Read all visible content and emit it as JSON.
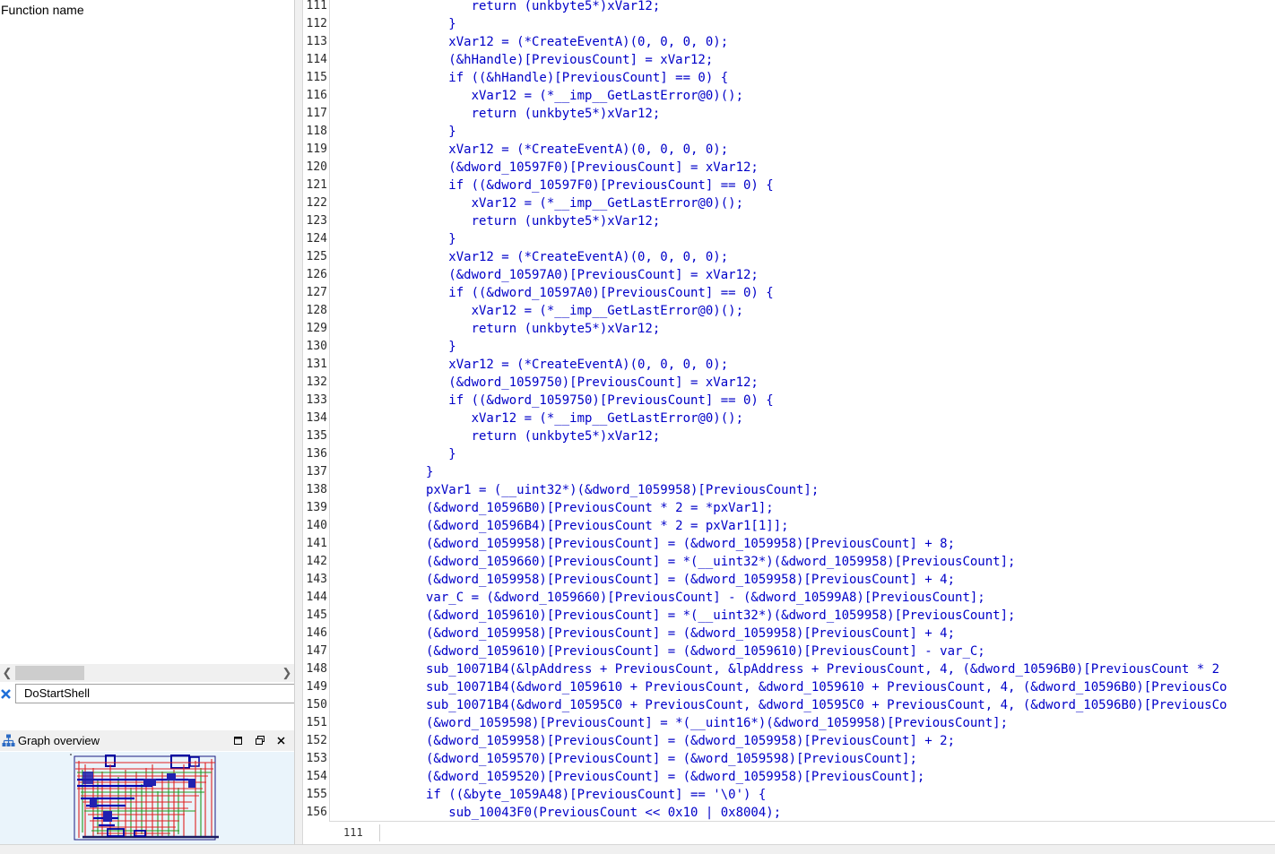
{
  "functions_panel": {
    "column_header": "Function name",
    "filter_value": "DoStartShell"
  },
  "graph_overview": {
    "title": "Graph overview"
  },
  "code_view": {
    "status_line": "111",
    "lines": [
      {
        "num": "111",
        "text": "      return (unkbyte5*)xVar12;"
      },
      {
        "num": "112",
        "text": "   }"
      },
      {
        "num": "113",
        "text": "   xVar12 = (*CreateEventA)(0, 0, 0, 0);"
      },
      {
        "num": "114",
        "text": "   (&hHandle)[PreviousCount] = xVar12;"
      },
      {
        "num": "115",
        "text": "   if ((&hHandle)[PreviousCount] == 0) {"
      },
      {
        "num": "116",
        "text": "      xVar12 = (*__imp__GetLastError@0)();"
      },
      {
        "num": "117",
        "text": "      return (unkbyte5*)xVar12;"
      },
      {
        "num": "118",
        "text": "   }"
      },
      {
        "num": "119",
        "text": "   xVar12 = (*CreateEventA)(0, 0, 0, 0);"
      },
      {
        "num": "120",
        "text": "   (&dword_10597F0)[PreviousCount] = xVar12;"
      },
      {
        "num": "121",
        "text": "   if ((&dword_10597F0)[PreviousCount] == 0) {"
      },
      {
        "num": "122",
        "text": "      xVar12 = (*__imp__GetLastError@0)();"
      },
      {
        "num": "123",
        "text": "      return (unkbyte5*)xVar12;"
      },
      {
        "num": "124",
        "text": "   }"
      },
      {
        "num": "125",
        "text": "   xVar12 = (*CreateEventA)(0, 0, 0, 0);"
      },
      {
        "num": "126",
        "text": "   (&dword_10597A0)[PreviousCount] = xVar12;"
      },
      {
        "num": "127",
        "text": "   if ((&dword_10597A0)[PreviousCount] == 0) {"
      },
      {
        "num": "128",
        "text": "      xVar12 = (*__imp__GetLastError@0)();"
      },
      {
        "num": "129",
        "text": "      return (unkbyte5*)xVar12;"
      },
      {
        "num": "130",
        "text": "   }"
      },
      {
        "num": "131",
        "text": "   xVar12 = (*CreateEventA)(0, 0, 0, 0);"
      },
      {
        "num": "132",
        "text": "   (&dword_1059750)[PreviousCount] = xVar12;"
      },
      {
        "num": "133",
        "text": "   if ((&dword_1059750)[PreviousCount] == 0) {"
      },
      {
        "num": "134",
        "text": "      xVar12 = (*__imp__GetLastError@0)();"
      },
      {
        "num": "135",
        "text": "      return (unkbyte5*)xVar12;"
      },
      {
        "num": "136",
        "text": "   }"
      },
      {
        "num": "137",
        "text": "}"
      },
      {
        "num": "138",
        "text": "pxVar1 = (__uint32*)(&dword_1059958)[PreviousCount];"
      },
      {
        "num": "139",
        "text": "(&dword_10596B0)[PreviousCount * 2 = *pxVar1];"
      },
      {
        "num": "140",
        "text": "(&dword_10596B4)[PreviousCount * 2 = pxVar1[1]];"
      },
      {
        "num": "141",
        "text": "(&dword_1059958)[PreviousCount] = (&dword_1059958)[PreviousCount] + 8;"
      },
      {
        "num": "142",
        "text": "(&dword_1059660)[PreviousCount] = *(__uint32*)(&dword_1059958)[PreviousCount];"
      },
      {
        "num": "143",
        "text": "(&dword_1059958)[PreviousCount] = (&dword_1059958)[PreviousCount] + 4;"
      },
      {
        "num": "144",
        "text": "var_C = (&dword_1059660)[PreviousCount] - (&dword_10599A8)[PreviousCount];"
      },
      {
        "num": "145",
        "text": "(&dword_1059610)[PreviousCount] = *(__uint32*)(&dword_1059958)[PreviousCount];"
      },
      {
        "num": "146",
        "text": "(&dword_1059958)[PreviousCount] = (&dword_1059958)[PreviousCount] + 4;"
      },
      {
        "num": "147",
        "text": "(&dword_1059610)[PreviousCount] = (&dword_1059610)[PreviousCount] - var_C;"
      },
      {
        "num": "148",
        "text": "sub_10071B4(&lpAddress + PreviousCount, &lpAddress + PreviousCount, 4, (&dword_10596B0)[PreviousCount * 2"
      },
      {
        "num": "149",
        "text": "sub_10071B4(&dword_1059610 + PreviousCount, &dword_1059610 + PreviousCount, 4, (&dword_10596B0)[PreviousCo"
      },
      {
        "num": "150",
        "text": "sub_10071B4(&dword_10595C0 + PreviousCount, &dword_10595C0 + PreviousCount, 4, (&dword_10596B0)[PreviousCo"
      },
      {
        "num": "151",
        "text": "(&word_1059598)[PreviousCount] = *(__uint16*)(&dword_1059958)[PreviousCount];"
      },
      {
        "num": "152",
        "text": "(&dword_1059958)[PreviousCount] = (&dword_1059958)[PreviousCount] + 2;"
      },
      {
        "num": "153",
        "text": "(&dword_1059570)[PreviousCount] = (&word_1059598)[PreviousCount];"
      },
      {
        "num": "154",
        "text": "(&dword_1059520)[PreviousCount] = (&dword_1059958)[PreviousCount];"
      },
      {
        "num": "155",
        "text": "if ((&byte_1059A48)[PreviousCount] == '\\0') {"
      },
      {
        "num": "156",
        "text": "   sub_10043F0(PreviousCount << 0x10 | 0x8004);"
      }
    ]
  },
  "colors": {
    "code_text": "#0000c8",
    "line_number": "#2b2b2b",
    "chrome_bg": "#f0f0f0",
    "graph_bg": "#eaf4fb"
  },
  "icons": {
    "filter_clear": "close-x-icon",
    "graph": "graph-nodes-icon",
    "restore": "restore-window-icon",
    "maximize": "maximize-icon",
    "close": "close-icon"
  }
}
